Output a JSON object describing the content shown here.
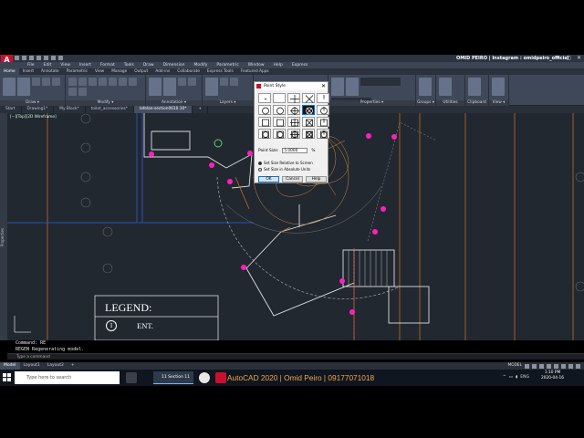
{
  "app": {
    "logo": "A",
    "title": "OMID PEIRO | Instagram : omidpeiro_official",
    "controls": [
      "—",
      "▢",
      "✕"
    ]
  },
  "menu": [
    "File",
    "Edit",
    "View",
    "Insert",
    "Format",
    "Tools",
    "Draw",
    "Dimension",
    "Modify",
    "Parametric",
    "Window",
    "Help",
    "Express"
  ],
  "tabs": [
    "Home",
    "Insert",
    "Annotate",
    "Parametric",
    "View",
    "Manage",
    "Output",
    "Add-ins",
    "Collaborate",
    "Express Tools",
    "Featured Apps"
  ],
  "ribbon_panels": [
    {
      "label": "Draw ▾"
    },
    {
      "label": "Modify ▾"
    },
    {
      "label": "Annotation ▾"
    },
    {
      "label": "Layers ▾"
    },
    {
      "label": "Block ▾"
    },
    {
      "label": "Properties ▾"
    },
    {
      "label": "Groups ▾"
    },
    {
      "label": "Utilities"
    },
    {
      "label": "Clipboard"
    },
    {
      "label": "View ▾"
    }
  ],
  "doc_tabs": [
    "Start",
    "Drawing1*",
    "My Block*",
    "toilet_accessories*",
    "lafelan-section0610.10*",
    "+"
  ],
  "view_label": "[−][Top][2D Wireframe]",
  "side_palette_label": "Properties",
  "dialog": {
    "title": "Point Style",
    "close": "✕",
    "point_size_label": "Point Size:",
    "point_size_value": "5.0000",
    "unit": "%",
    "radio_relative": "Set Size Relative to Screen",
    "radio_absolute": "Set Size in Absolute Units",
    "ok": "OK",
    "cancel": "Cancel",
    "help": "Help"
  },
  "legend": {
    "title": "LEGEND:",
    "symbol": "I",
    "entry": "ENT."
  },
  "command_history": [
    "Command: RE",
    "REGEN Regenerating model."
  ],
  "command_placeholder": "Type a command",
  "layout_tabs": [
    "Model",
    "Layout1",
    "Layout2",
    "+"
  ],
  "status_model": "MODEL",
  "taskbar": {
    "search_placeholder": "Type here to search",
    "task_label": "11 Section 11",
    "watermark": "AutoCAD 2020 | Omid Peiro | 09177071018",
    "lang": "ENG",
    "time": "1:10 PM",
    "date": "2020-04-16"
  },
  "colors": {
    "canvas": "#212830",
    "points": "#ff1fbf",
    "orange_lines": "#c76a2a",
    "blue_lines": "#2a4fb0"
  }
}
